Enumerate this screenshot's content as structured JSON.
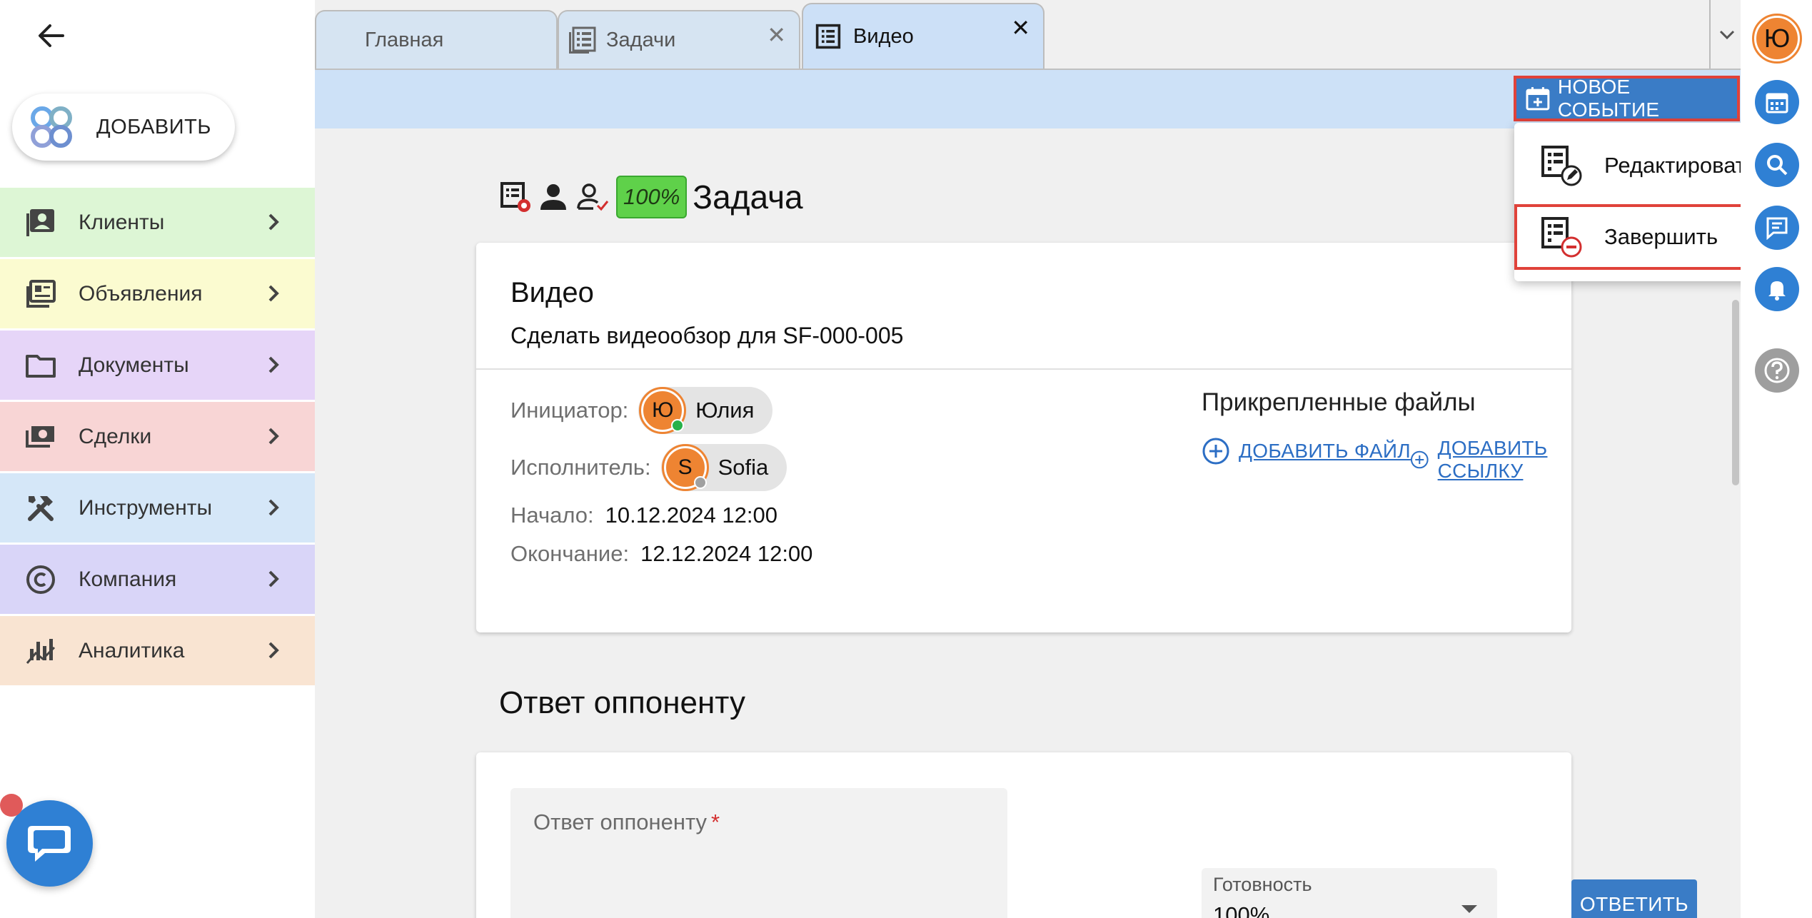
{
  "sidebar": {
    "add_label": "ДОБАВИТЬ",
    "items": [
      {
        "label": "Клиенты",
        "icon": "contacts-icon",
        "color": "#ddf6d5"
      },
      {
        "label": "Объявления",
        "icon": "listing-icon",
        "color": "#fbfbd0"
      },
      {
        "label": "Документы",
        "icon": "folder-icon",
        "color": "#e6d5f8"
      },
      {
        "label": "Сделки",
        "icon": "money-icon",
        "color": "#f8d5d5"
      },
      {
        "label": "Инструменты",
        "icon": "tools-icon",
        "color": "#d5e7f8"
      },
      {
        "label": "Компания",
        "icon": "copyright-icon",
        "color": "#d9d5f8"
      },
      {
        "label": "Аналитика",
        "icon": "analytics-icon",
        "color": "#f9e4d2"
      }
    ]
  },
  "tabs": [
    {
      "label": "Главная"
    },
    {
      "label": "Задачи",
      "close": "✕"
    },
    {
      "label": "Видео",
      "close": "✕",
      "active": true
    }
  ],
  "toolbar": {
    "new_event_label": "НОВОЕ СОБЫТИЕ"
  },
  "menu": {
    "items": [
      {
        "label": "Редактировать",
        "icon": "edit-task-icon"
      },
      {
        "label": "Завершить",
        "icon": "finish-task-icon"
      }
    ]
  },
  "task": {
    "progress_badge": "100%",
    "header_title": "Задача",
    "title": "Видео",
    "subtitle": "Сделать видеообзор для SF-000-005",
    "initiator_label": "Инициатор:",
    "initiator_initial": "Ю",
    "initiator_name": "Юлия",
    "executor_label": "Исполнитель:",
    "executor_initial": "S",
    "executor_name": "Sofia",
    "start_label": "Начало:",
    "start_value": "10.12.2024 12:00",
    "end_label": "Окончание:",
    "end_value": "12.12.2024 12:00",
    "attached_title": "Прикрепленные файлы",
    "add_file": "ДОБАВИТЬ ФАЙЛ",
    "add_link": "ДОБАВИТЬ ССЫЛКУ"
  },
  "reply": {
    "section_title": "Ответ оппоненту",
    "textarea_placeholder": "Ответ оппоненту",
    "required_mark": "*",
    "readiness_label": "Готовность",
    "readiness_value": "100%",
    "submit_label": "ОТВЕТИТЬ"
  },
  "rail": {
    "user_initial": "Ю"
  },
  "colors": {
    "accent": "#3a7cc6",
    "highlight": "#e0423a",
    "avatar": "#ee8432",
    "badge": "#5fd14a"
  }
}
